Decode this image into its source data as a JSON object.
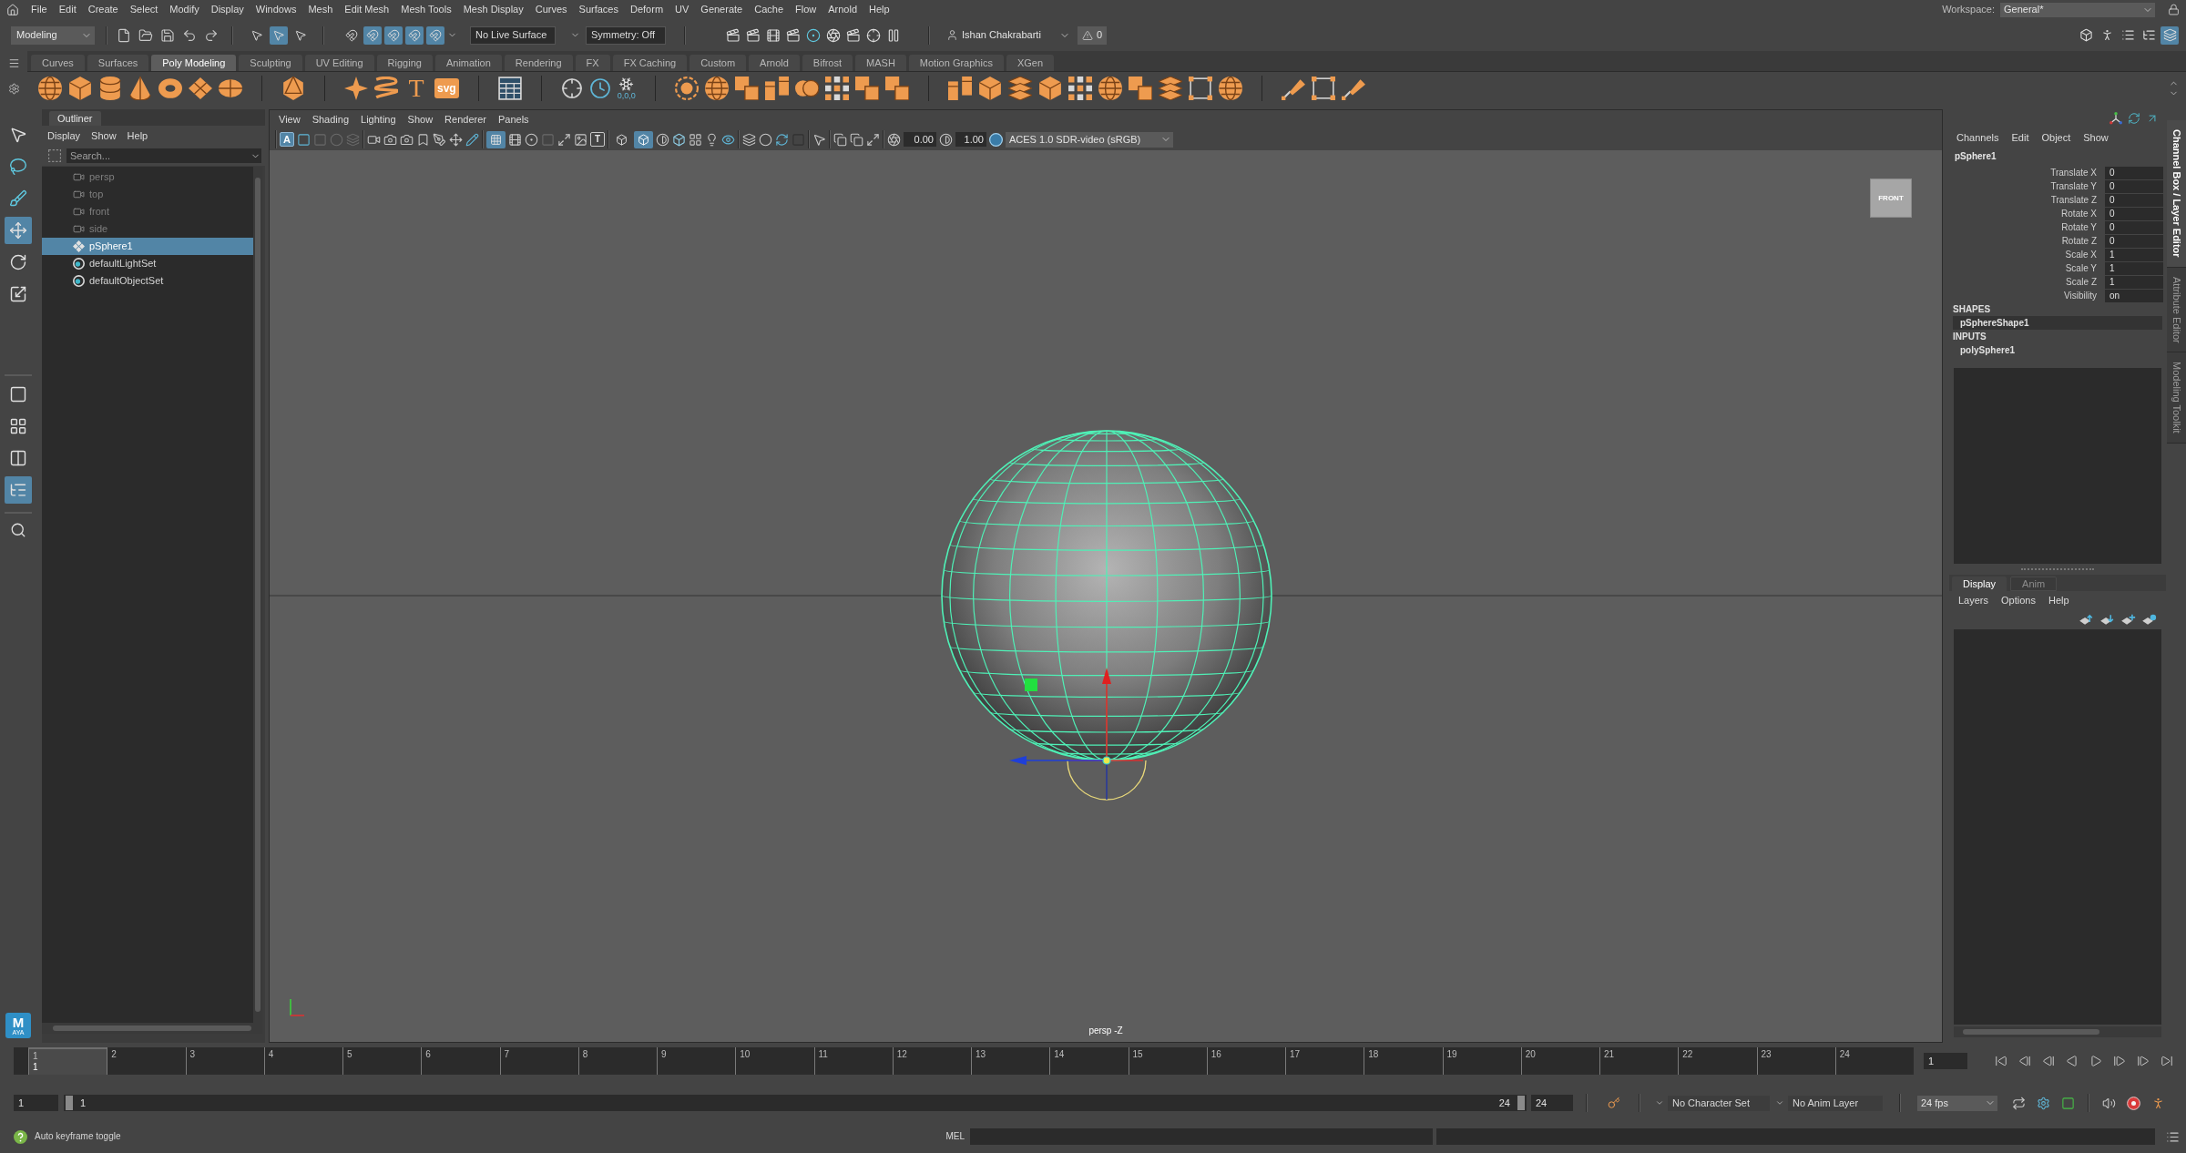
{
  "menu_bar": {
    "items": [
      "File",
      "Edit",
      "Create",
      "Select",
      "Modify",
      "Display",
      "Windows",
      "Mesh",
      "Edit Mesh",
      "Mesh Tools",
      "Mesh Display",
      "Curves",
      "Surfaces",
      "Deform",
      "UV",
      "Generate",
      "Cache",
      "Flow",
      "Arnold",
      "Help"
    ],
    "workspace_label": "Workspace:",
    "workspace": "General*"
  },
  "status_line": {
    "menu_set": "Modeling",
    "hierarchy_modes": [
      {
        "selected": false
      },
      {
        "selected": true
      },
      {
        "selected": false
      }
    ],
    "snap_toggles": [
      {
        "selected": false
      },
      {
        "selected": true
      },
      {
        "selected": true
      },
      {
        "selected": true
      },
      {
        "selected": true
      }
    ],
    "live_surface": "No Live Surface",
    "symmetry": "Symmetry: Off",
    "user": "Ishan Chakrabarti",
    "warning_count": "0",
    "panel_toggles": [
      {
        "selected": false
      },
      {
        "selected": false
      },
      {
        "selected": false
      },
      {
        "selected": false
      },
      {
        "selected": true
      }
    ]
  },
  "shelf": {
    "tabs": [
      {
        "label": "Curves",
        "selected": false
      },
      {
        "label": "Surfaces",
        "selected": false
      },
      {
        "label": "Poly Modeling",
        "selected": true
      },
      {
        "label": "Sculpting",
        "selected": false
      },
      {
        "label": "UV Editing",
        "selected": false
      },
      {
        "label": "Rigging",
        "selected": false
      },
      {
        "label": "Animation",
        "selected": false
      },
      {
        "label": "Rendering",
        "selected": false
      },
      {
        "label": "FX",
        "selected": false
      },
      {
        "label": "FX Caching",
        "selected": false
      },
      {
        "label": "Custom",
        "selected": false
      },
      {
        "label": "Arnold",
        "selected": false
      },
      {
        "label": "Bifrost",
        "selected": false
      },
      {
        "label": "MASH",
        "selected": false
      },
      {
        "label": "Motion Graphics",
        "selected": false
      },
      {
        "label": "XGen",
        "selected": false
      }
    ],
    "text_tool_label": "T",
    "svg_tool_label": "svg",
    "snap_values_label": "0,0,0"
  },
  "toolbox": {
    "tools": [
      {
        "kind": "select",
        "selected": false
      },
      {
        "kind": "lasso",
        "selected": false
      },
      {
        "kind": "paint",
        "selected": false
      },
      {
        "kind": "move",
        "selected": true
      },
      {
        "kind": "rotate",
        "selected": false
      },
      {
        "kind": "scale",
        "selected": false
      }
    ],
    "layouts": [
      {
        "kind": "single",
        "selected": false
      },
      {
        "kind": "four",
        "selected": false
      },
      {
        "kind": "two",
        "selected": false
      },
      {
        "kind": "outliner",
        "selected": true
      }
    ],
    "logo_letter": "M",
    "logo_caption": "AYA"
  },
  "outliner": {
    "title": "Outliner",
    "menu": [
      "Display",
      "Show",
      "Help"
    ],
    "search_placeholder": "Search...",
    "items": [
      {
        "label": "persp",
        "kind": "camera",
        "dimmed": true,
        "selected": false
      },
      {
        "label": "top",
        "kind": "camera",
        "dimmed": true,
        "selected": false
      },
      {
        "label": "front",
        "kind": "camera",
        "dimmed": true,
        "selected": false
      },
      {
        "label": "side",
        "kind": "camera",
        "dimmed": true,
        "selected": false
      },
      {
        "label": "pSphere1",
        "kind": "mesh",
        "dimmed": false,
        "selected": true
      },
      {
        "label": "defaultLightSet",
        "kind": "set",
        "dimmed": false,
        "selected": false
      },
      {
        "label": "defaultObjectSet",
        "kind": "set",
        "dimmed": false,
        "selected": false
      }
    ]
  },
  "viewport": {
    "menu": [
      "View",
      "Shading",
      "Lighting",
      "Show",
      "Renderer",
      "Panels"
    ],
    "camera_letter": {
      "letter": "A",
      "selected": true
    },
    "grid_toggle": {
      "selected": true
    },
    "text_toggle": {
      "letter": "T",
      "selected": false
    },
    "wireframe_toggle": {
      "selected": false
    },
    "shaded_toggle": {
      "selected": true
    },
    "exposure": "0.00",
    "gamma": "1.00",
    "color_space": "ACES 1.0 SDR-video (sRGB)",
    "view_cube_label": "FRONT",
    "camera_label": "persp -Z"
  },
  "channel_box": {
    "menu": [
      "Channels",
      "Edit",
      "Object",
      "Show"
    ],
    "object": "pSphere1",
    "attributes": [
      {
        "label": "Translate X",
        "value": "0"
      },
      {
        "label": "Translate Y",
        "value": "0"
      },
      {
        "label": "Translate Z",
        "value": "0"
      },
      {
        "label": "Rotate X",
        "value": "0"
      },
      {
        "label": "Rotate Y",
        "value": "0"
      },
      {
        "label": "Rotate Z",
        "value": "0"
      },
      {
        "label": "Scale X",
        "value": "1"
      },
      {
        "label": "Scale Y",
        "value": "1"
      },
      {
        "label": "Scale Z",
        "value": "1"
      },
      {
        "label": "Visibility",
        "value": "on"
      }
    ],
    "shapes_heading": "SHAPES",
    "shapes": [
      {
        "label": "pSphereShape1",
        "selected": true
      }
    ],
    "inputs_heading": "INPUTS",
    "inputs": [
      {
        "label": "polySphere1",
        "selected": false
      }
    ]
  },
  "layer_editor": {
    "tabs": [
      {
        "label": "Display",
        "selected": true
      },
      {
        "label": "Anim",
        "selected": false
      }
    ],
    "menu": [
      "Layers",
      "Options",
      "Help"
    ]
  },
  "side_tabs": [
    {
      "label": "Channel Box / Layer Editor",
      "selected": true
    },
    {
      "label": "Attribute Editor",
      "selected": false
    },
    {
      "label": "Modeling Toolkit",
      "selected": false
    }
  ],
  "timeline": {
    "frames": [
      {
        "label": "1",
        "current": true
      },
      {
        "label": "2",
        "current": false
      },
      {
        "label": "3",
        "current": false
      },
      {
        "label": "4",
        "current": false
      },
      {
        "label": "5",
        "current": false
      },
      {
        "label": "6",
        "current": false
      },
      {
        "label": "7",
        "current": false
      },
      {
        "label": "8",
        "current": false
      },
      {
        "label": "9",
        "current": false
      },
      {
        "label": "10",
        "current": false
      },
      {
        "label": "11",
        "current": false
      },
      {
        "label": "12",
        "current": false
      },
      {
        "label": "13",
        "current": false
      },
      {
        "label": "14",
        "current": false
      },
      {
        "label": "15",
        "current": false
      },
      {
        "label": "16",
        "current": false
      },
      {
        "label": "17",
        "current": false
      },
      {
        "label": "18",
        "current": false
      },
      {
        "label": "19",
        "current": false
      },
      {
        "label": "20",
        "current": false
      },
      {
        "label": "21",
        "current": false
      },
      {
        "label": "22",
        "current": false
      },
      {
        "label": "23",
        "current": false
      },
      {
        "label": "24",
        "current": false
      }
    ],
    "current_frame_label": "1",
    "current_frame_field": "1"
  },
  "range_slider": {
    "start": "1",
    "range_start": "1",
    "range_end": "24",
    "end": "24",
    "character_set": "No Character Set",
    "anim_layer": "No Anim Layer",
    "fps": "24 fps",
    "auto_key": {
      "on": true
    }
  },
  "help_line": {
    "text": "Auto keyframe toggle"
  },
  "command_line": {
    "language": "MEL"
  }
}
